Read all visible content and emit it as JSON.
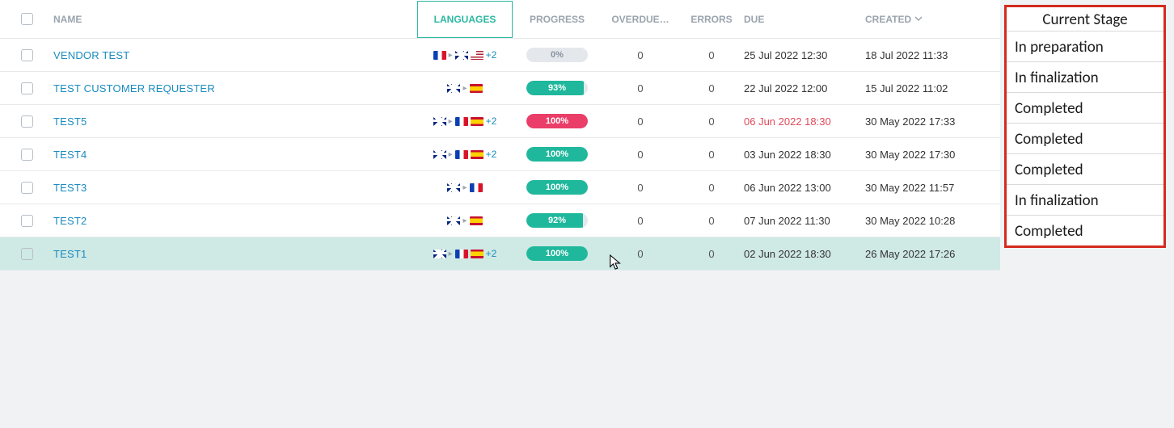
{
  "columns": {
    "name": "NAME",
    "languages": "LANGUAGES",
    "progress": "PROGRESS",
    "overdue": "OVERDUE…",
    "errors": "ERRORS",
    "due": "DUE",
    "created": "CREATED"
  },
  "rows": [
    {
      "name": "VENDOR TEST",
      "src_flags": [
        "fr"
      ],
      "dst_flags": [
        "uk",
        "us"
      ],
      "more": "+2",
      "progress": {
        "pct": 0,
        "label": "0%",
        "style": "gray"
      },
      "overdue": "0",
      "errors": "0",
      "due": "25 Jul 2022 12:30",
      "due_overdue": false,
      "created": "18 Jul 2022 11:33"
    },
    {
      "name": "TEST CUSTOMER REQUESTER",
      "src_flags": [
        "uk"
      ],
      "dst_flags": [
        "es"
      ],
      "more": "",
      "progress": {
        "pct": 93,
        "label": "93%",
        "style": "teal"
      },
      "overdue": "0",
      "errors": "0",
      "due": "22 Jul 2022 12:00",
      "due_overdue": false,
      "created": "15 Jul 2022 11:02"
    },
    {
      "name": "TEST5",
      "src_flags": [
        "uk"
      ],
      "dst_flags": [
        "fr",
        "es"
      ],
      "more": "+2",
      "progress": {
        "pct": 100,
        "label": "100%",
        "style": "red"
      },
      "overdue": "0",
      "errors": "0",
      "due": "06 Jun 2022 18:30",
      "due_overdue": true,
      "created": "30 May 2022 17:33"
    },
    {
      "name": "TEST4",
      "src_flags": [
        "uk"
      ],
      "dst_flags": [
        "fr",
        "es"
      ],
      "more": "+2",
      "progress": {
        "pct": 100,
        "label": "100%",
        "style": "teal"
      },
      "overdue": "0",
      "errors": "0",
      "due": "03 Jun 2022 18:30",
      "due_overdue": false,
      "created": "30 May 2022 17:30"
    },
    {
      "name": "TEST3",
      "src_flags": [
        "uk"
      ],
      "dst_flags": [
        "fr"
      ],
      "more": "",
      "progress": {
        "pct": 100,
        "label": "100%",
        "style": "teal"
      },
      "overdue": "0",
      "errors": "0",
      "due": "06 Jun 2022 13:00",
      "due_overdue": false,
      "created": "30 May 2022 11:57"
    },
    {
      "name": "TEST2",
      "src_flags": [
        "uk"
      ],
      "dst_flags": [
        "es"
      ],
      "more": "",
      "progress": {
        "pct": 92,
        "label": "92%",
        "style": "teal"
      },
      "overdue": "0",
      "errors": "0",
      "due": "07 Jun 2022 11:30",
      "due_overdue": false,
      "created": "30 May 2022 10:28"
    },
    {
      "name": "TEST1",
      "src_flags": [
        "uk"
      ],
      "dst_flags": [
        "fr",
        "es"
      ],
      "more": "+2",
      "progress": {
        "pct": 100,
        "label": "100%",
        "style": "teal"
      },
      "overdue": "0",
      "errors": "0",
      "due": "02 Jun 2022 18:30",
      "due_overdue": false,
      "created": "26 May 2022 17:26",
      "hovered": true
    }
  ],
  "overlay": {
    "title": "Current Stage",
    "items": [
      "In preparation",
      "In finalization",
      "Completed",
      "Completed",
      "Completed",
      "In finalization",
      "Completed"
    ]
  }
}
